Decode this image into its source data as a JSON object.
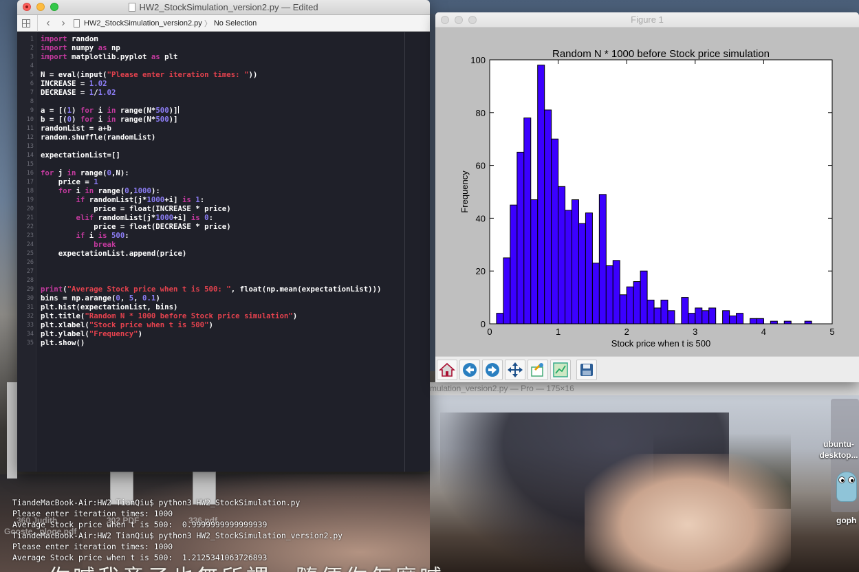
{
  "editor": {
    "window_title": "HW2_StockSimulation_version2.py — Edited",
    "jump_file": "HW2_StockSimulation_version2.py",
    "jump_selection": "No Selection",
    "line_count": 35
  },
  "figure": {
    "window_title": "Figure 1",
    "toolbar_buttons": [
      "home-icon",
      "back-arrow-icon",
      "forward-arrow-icon",
      "pan-icon",
      "zoom-icon",
      "configure-subplots-icon",
      "save-icon"
    ]
  },
  "chart_data": {
    "type": "bar",
    "title": "Random N * 1000 before Stock price simulation",
    "xlabel": "Stock price when t is 500",
    "ylabel": "Frequency",
    "xlim": [
      0,
      5
    ],
    "ylim": [
      0,
      100
    ],
    "xticks": [
      "0",
      "1",
      "2",
      "3",
      "4",
      "5"
    ],
    "yticks": [
      "0",
      "20",
      "40",
      "60",
      "80",
      "100"
    ],
    "bin_width": 0.1,
    "bin_starts": [
      0.1,
      0.2,
      0.3,
      0.4,
      0.5,
      0.6,
      0.7,
      0.8,
      0.9,
      1.0,
      1.1,
      1.2,
      1.3,
      1.4,
      1.5,
      1.6,
      1.7,
      1.8,
      1.9,
      2.0,
      2.1,
      2.2,
      2.3,
      2.4,
      2.5,
      2.6,
      2.7,
      2.8,
      2.9,
      3.0,
      3.1,
      3.2,
      3.3,
      3.4,
      3.5,
      3.6,
      3.7,
      3.8,
      3.9,
      4.0,
      4.1,
      4.2,
      4.3,
      4.4,
      4.5,
      4.6,
      4.7
    ],
    "values": [
      4,
      25,
      45,
      65,
      78,
      47,
      98,
      81,
      70,
      52,
      43,
      47,
      38,
      42,
      23,
      49,
      22,
      24,
      11,
      14,
      16,
      20,
      9,
      6,
      9,
      5,
      0,
      10,
      4,
      6,
      5,
      6,
      0,
      5,
      3,
      4,
      0,
      2,
      2,
      0,
      1,
      0,
      1,
      0,
      0,
      1,
      0
    ],
    "bar_color": "#3b00ff",
    "grid": false
  },
  "background": {
    "strip_text": "mulation_version2.py — Pro — 175×16",
    "desktop_label": "ubuntu-\ndesktop...",
    "gopher_label": "goph",
    "ghost_labels": [
      "360 Judith",
      "302 PDF",
      "336.pdf",
      "Gooste...ploge.pdf"
    ],
    "subtitle": "你喊我童子也無所謂，隨便你怎麼喊"
  },
  "terminal": {
    "lines": [
      "TiandeMacBook-Air:HW2 TianQiu$ python3 HW2_StockSimulation.py",
      "Please enter iteration times: 1000",
      "Average Stock price when t is 500:  0.9999999999999939",
      "TiandeMacBook-Air:HW2 TianQiu$ python3 HW2_StockSimulation_version2.py",
      "Please enter iteration times: 1000",
      "Average Stock price when t is 500:  1.2125341063726893"
    ]
  }
}
